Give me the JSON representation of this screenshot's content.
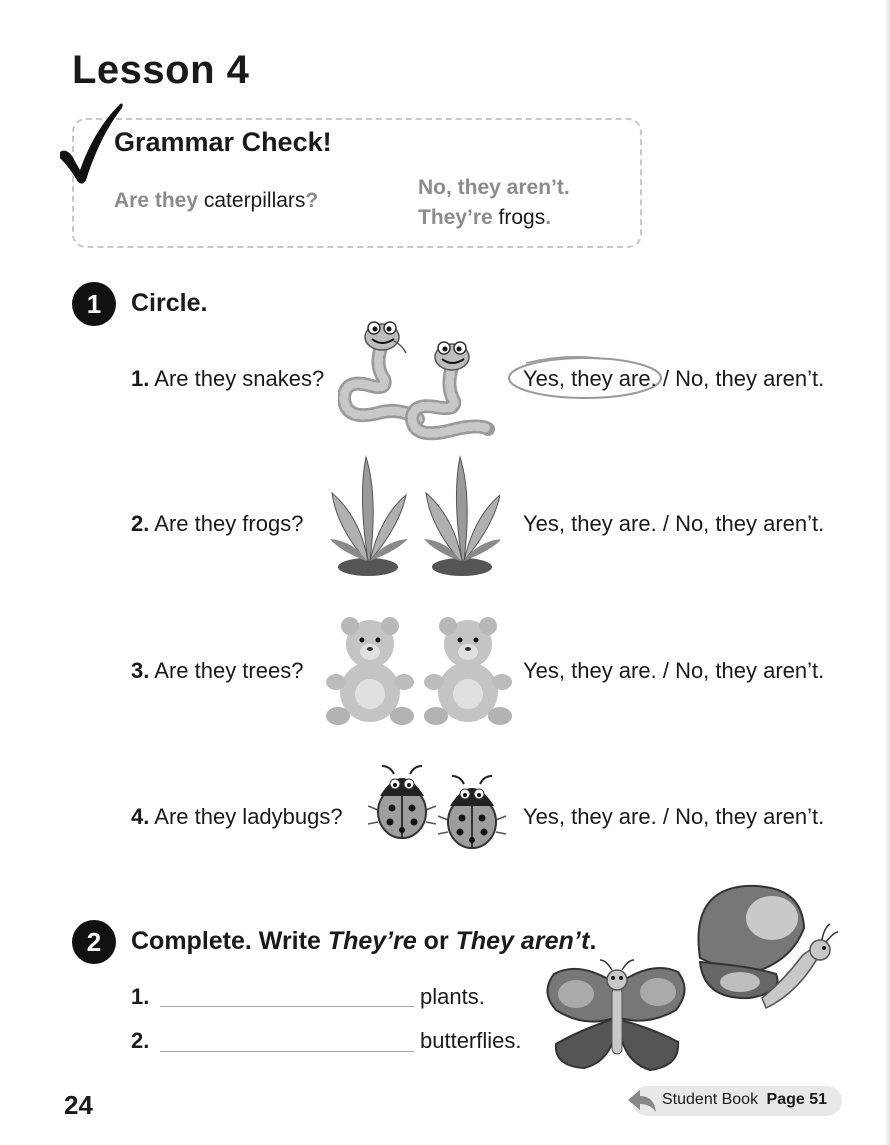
{
  "lesson_title": "Lesson 4",
  "grammar_check": {
    "title": "Grammar Check!",
    "question_prefix": "Are they",
    "question_noun": "caterpillars",
    "question_mark": "?",
    "answer_line1": "No, they aren’t.",
    "answer_line2_prefix": "They’re",
    "answer_line2_noun": "frogs",
    "answer_line2_end": "."
  },
  "section1": {
    "number": "1",
    "title": "Circle.",
    "items": [
      {
        "num": "1.",
        "question": "Are they snakes?",
        "picture": "two snakes",
        "yes": "Yes, they are.",
        "sep": " / ",
        "no": "No, they aren’t.",
        "circled": "yes"
      },
      {
        "num": "2.",
        "question": "Are they frogs?",
        "picture": "two plants",
        "yes": "Yes, they are.",
        "sep": " / ",
        "no": "No, they aren’t."
      },
      {
        "num": "3.",
        "question": "Are they trees?",
        "picture": "two teddy bears",
        "yes": "Yes, they are.",
        "sep": " / ",
        "no": "No, they aren’t."
      },
      {
        "num": "4.",
        "question": "Are they ladybugs?",
        "picture": "two ladybugs",
        "yes": "Yes, they are.",
        "sep": " / ",
        "no": "No, they aren’t."
      }
    ]
  },
  "section2": {
    "number": "2",
    "title_start": "Complete. Write ",
    "title_em1": "They’re",
    "title_mid": " or ",
    "title_em2": "They aren’t",
    "title_end": ".",
    "items": [
      {
        "num": "1.",
        "word": "plants."
      },
      {
        "num": "2.",
        "word": "butterflies."
      }
    ]
  },
  "footer": {
    "page_number": "24",
    "student_book_label": "Student Book",
    "page_ref": "Page 51"
  }
}
